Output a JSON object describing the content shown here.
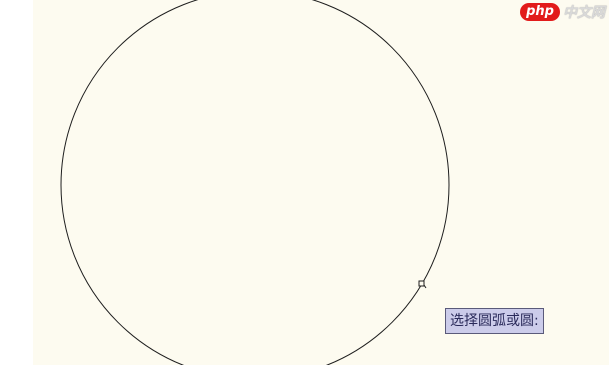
{
  "canvas": {
    "background_color": "#fdfbf0",
    "line_color": "#1e1e1e"
  },
  "cursor": {
    "icon": "pickbox-cursor-icon"
  },
  "prompt": {
    "text": "选择圆弧或圆:",
    "background_color": "#ccccea",
    "text_color": "#2a2a5a"
  },
  "watermark": {
    "badge": "php",
    "text": "中文网",
    "badge_color": "#e21b1b"
  }
}
